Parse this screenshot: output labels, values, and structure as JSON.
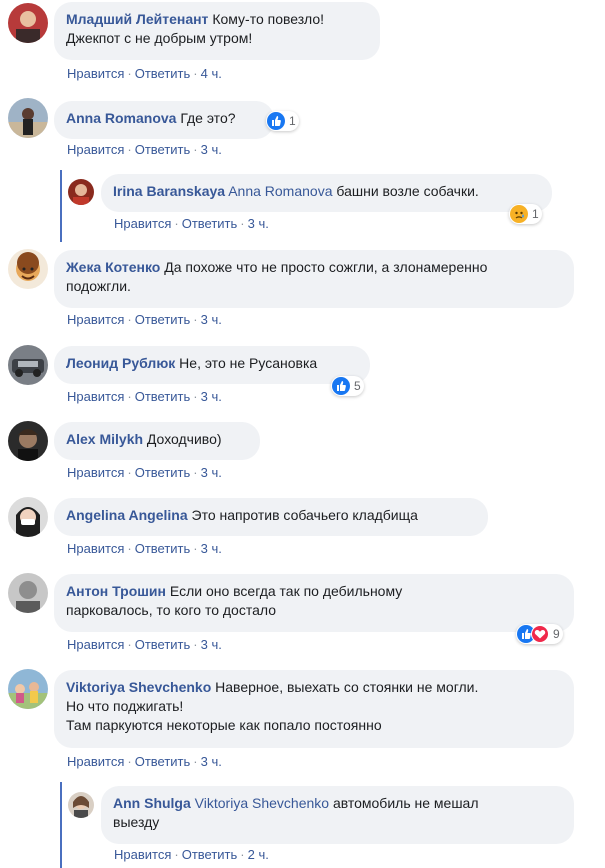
{
  "actions": {
    "like": "Нравится",
    "reply": "Ответить",
    "sep": "·"
  },
  "comments": [
    {
      "author": "Младший Лейтенант",
      "text": "Кому-то повезло!",
      "text2": "Джекпот с не добрым утром!",
      "time": "4 ч."
    },
    {
      "author": "Anna Romanova",
      "text": "Где это?",
      "time": "3 ч.",
      "reactions": "1"
    },
    {
      "author": "Irina Baranskaya",
      "mention": "Anna Romanova",
      "text": "башни возле собачки.",
      "time": "3 ч.",
      "reactions": "1"
    },
    {
      "author": "Жека Котенко",
      "text": "Да похоже что не просто сожгли, а злонамеренно",
      "text2": "подожгли.",
      "time": "3 ч."
    },
    {
      "author": "Леонид Рублюк",
      "text": "Не, это не Русановка",
      "time": "3 ч.",
      "reactions": "5"
    },
    {
      "author": "Alex Milykh",
      "text": "Доходчиво)",
      "time": "3 ч."
    },
    {
      "author": "Angelina Angelina",
      "text": "Это напротив собачьего кладбища",
      "time": "3 ч."
    },
    {
      "author": "Антон Трошин",
      "text": "Если оно всегда так по дебильному",
      "text2": "парковалось, то кого то достало",
      "time": "3 ч.",
      "reactions": "9"
    },
    {
      "author": "Viktoriya Shevchenko",
      "text": "Наверное, выехать со стоянки не могли.",
      "text2": "Но что поджигать!",
      "text3": "Там паркуются некоторые как попало постоянно",
      "time": "3 ч."
    },
    {
      "author": "Ann Shulga",
      "mention": "Viktoriya Shevchenko",
      "text": "автомобиль не мешал",
      "text2": "выезду",
      "time": "2 ч."
    }
  ]
}
